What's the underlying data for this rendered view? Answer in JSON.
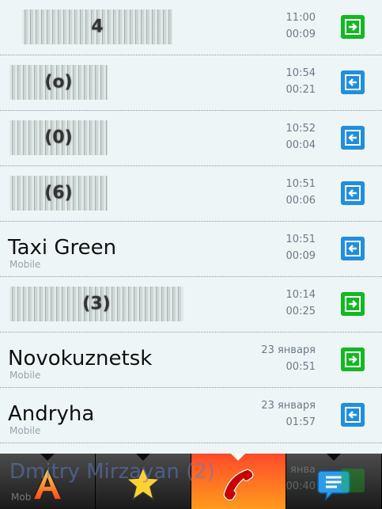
{
  "calls": [
    {
      "name": "",
      "number_fragment": "4",
      "subtitle": "",
      "time": "11:00",
      "duration": "00:09",
      "type": "outgoing",
      "icon": "outgoing-call-icon",
      "color": "#12b922"
    },
    {
      "name": "",
      "number_fragment": "(o)",
      "subtitle": "",
      "time": "10:54",
      "duration": "00:21",
      "type": "incoming",
      "icon": "incoming-call-icon",
      "color": "#1f8fe0"
    },
    {
      "name": "",
      "number_fragment": "(0)",
      "subtitle": "",
      "time": "10:52",
      "duration": "00:04",
      "type": "incoming",
      "icon": "incoming-call-icon",
      "color": "#1f8fe0"
    },
    {
      "name": "",
      "number_fragment": "(6)",
      "subtitle": "",
      "time": "10:51",
      "duration": "00:06",
      "type": "incoming",
      "icon": "incoming-call-icon",
      "color": "#1f8fe0"
    },
    {
      "name": "Taxi Green",
      "number_fragment": "",
      "subtitle": "Mobile",
      "time": "10:51",
      "duration": "00:09",
      "type": "incoming",
      "icon": "incoming-call-icon",
      "color": "#1f8fe0"
    },
    {
      "name": "",
      "number_fragment": "(3)",
      "subtitle": "",
      "time": "10:14",
      "duration": "00:25",
      "type": "outgoing",
      "icon": "outgoing-call-icon",
      "color": "#12b922"
    },
    {
      "name": "Novokuznetsk",
      "number_fragment": "",
      "subtitle": "Mobile",
      "time": "23 января",
      "duration": "00:51",
      "type": "outgoing",
      "icon": "outgoing-call-icon",
      "color": "#12b922"
    },
    {
      "name": "Andryha",
      "number_fragment": "",
      "subtitle": "Mobile",
      "time": "23 января",
      "duration": "01:57",
      "type": "incoming",
      "icon": "incoming-call-icon",
      "color": "#1f8fe0"
    }
  ],
  "partial_row": {
    "name": "Dmitry Mirzayan (2)",
    "subtitle": "Mob",
    "time": "янва",
    "duration": "00:40"
  },
  "tabs": [
    {
      "id": "contacts",
      "icon": "letter-a-icon",
      "active": false
    },
    {
      "id": "favorites",
      "icon": "star-icon",
      "active": false
    },
    {
      "id": "call-log",
      "icon": "phone-handset-icon",
      "active": true
    },
    {
      "id": "messages",
      "icon": "speech-bubble-icon",
      "active": false
    }
  ],
  "colors": {
    "outgoing": "#12b922",
    "incoming": "#1f8fe0",
    "active_tab_top": "#ff4a2a",
    "active_tab_bottom": "#ff9a1c",
    "background": "#eef5f7"
  }
}
